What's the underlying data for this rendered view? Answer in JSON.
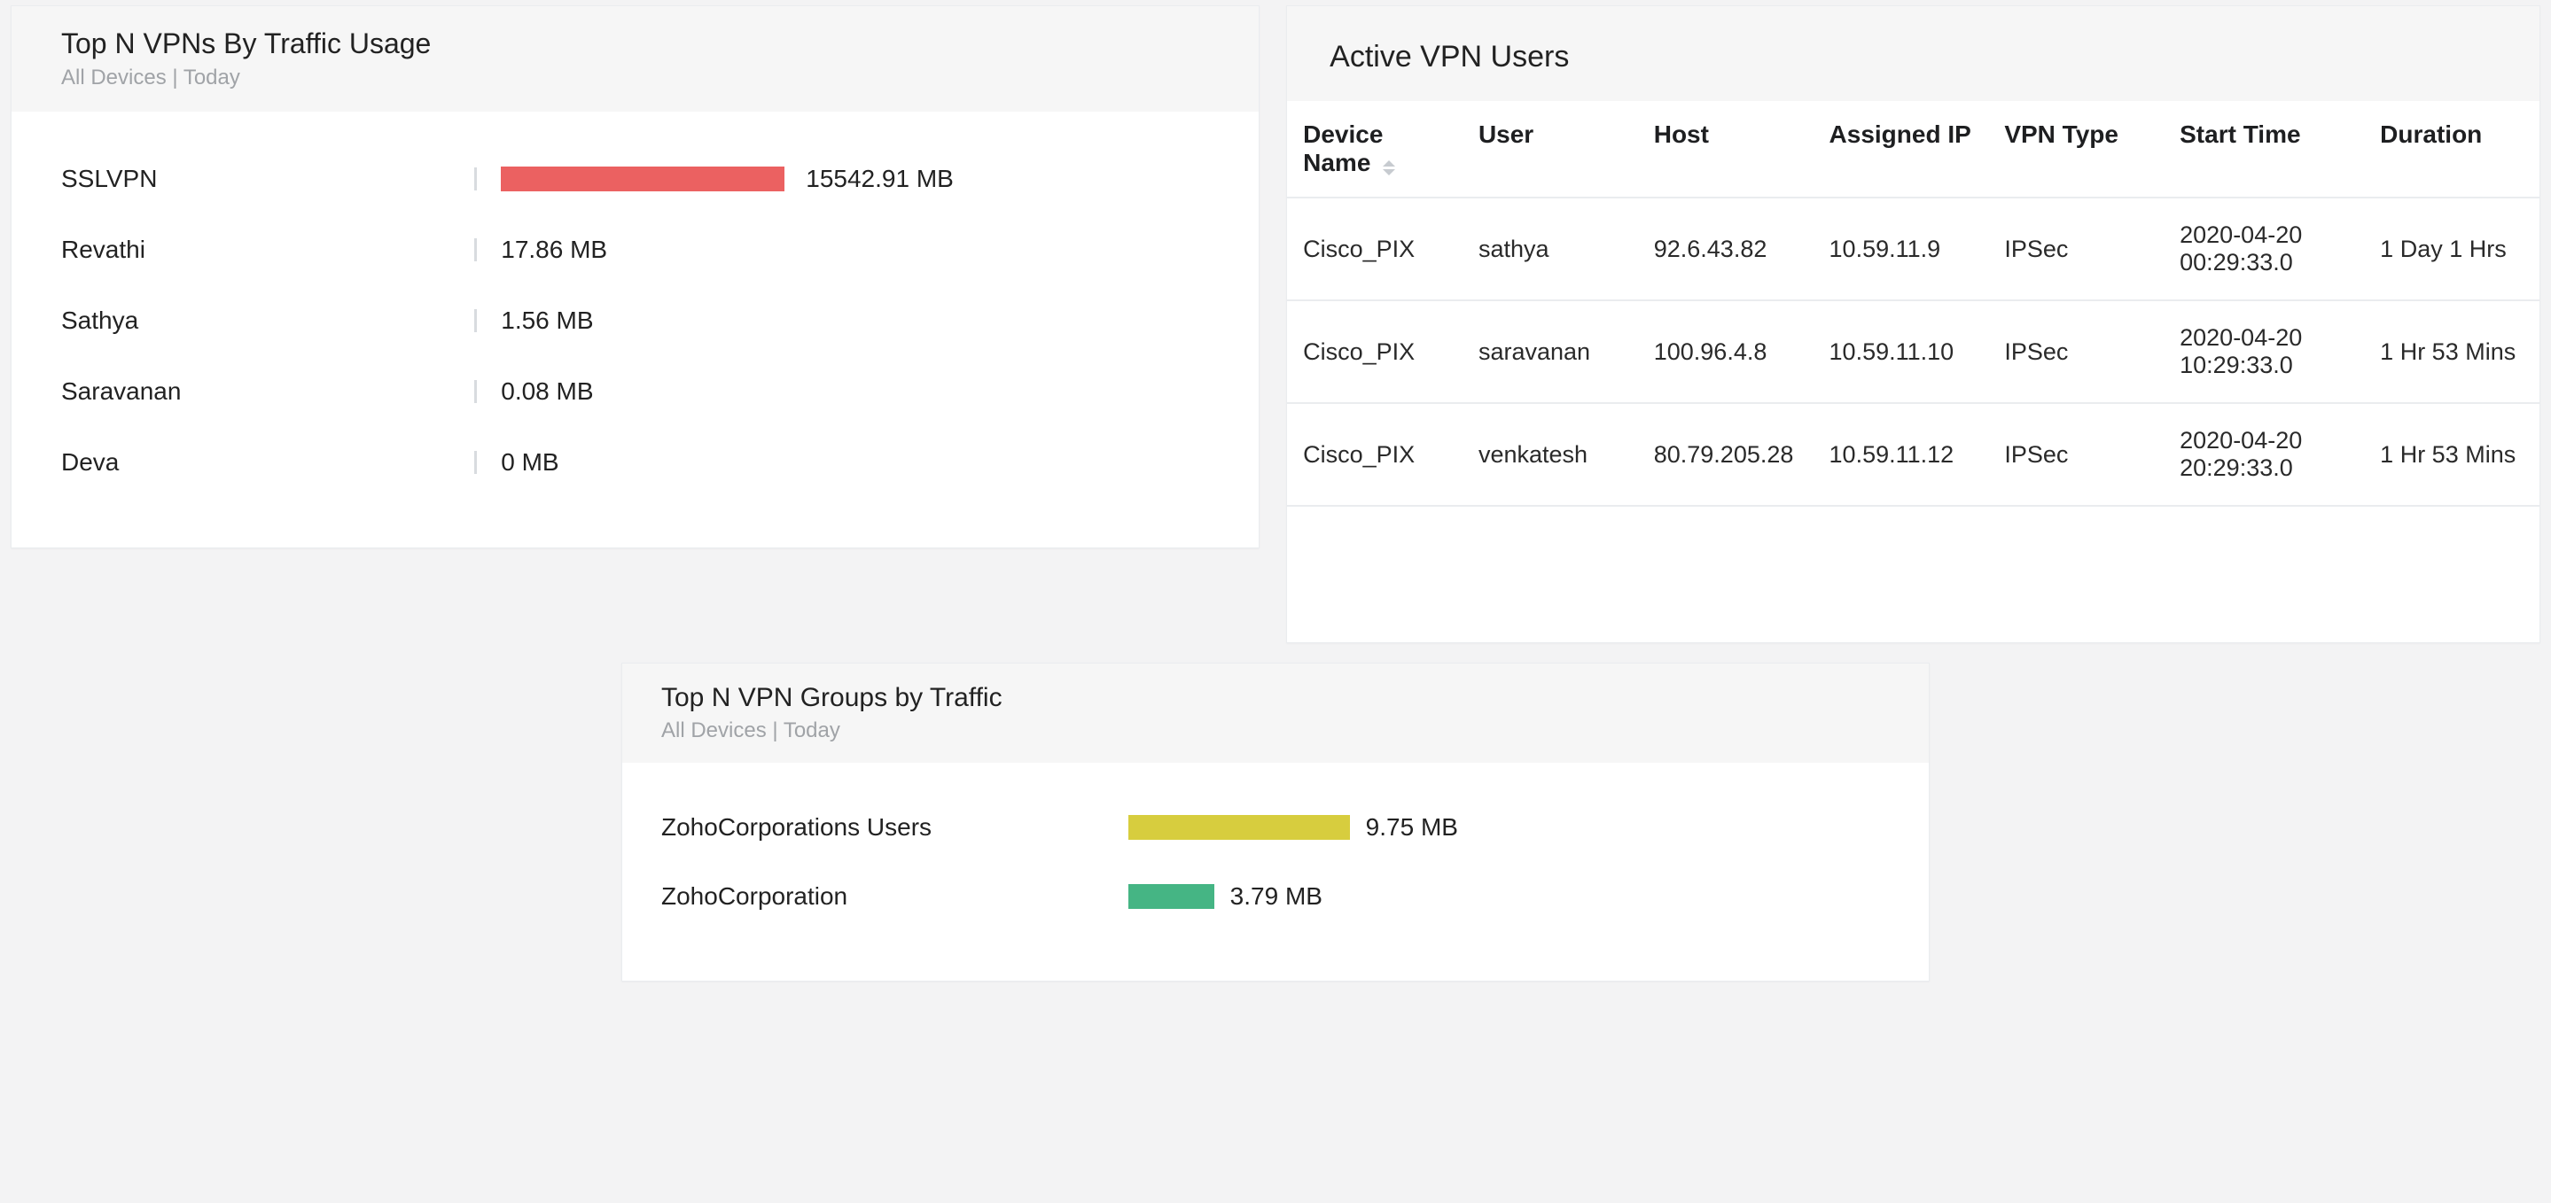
{
  "colors": {
    "bar_red": "#eb6161",
    "bar_yellow": "#d7cd3e",
    "bar_green": "#45b584"
  },
  "panels": {
    "traffic": {
      "title": "Top N VPNs By Traffic Usage",
      "subtitle": "All Devices | Today"
    },
    "active": {
      "title": "Active VPN Users",
      "columns": {
        "device": "Device Name",
        "user": "User",
        "host": "Host",
        "assigned_ip": "Assigned IP",
        "vpn_type": "VPN Type",
        "start_time": "Start Time",
        "duration": "Duration"
      },
      "rows": [
        {
          "device": "Cisco_PIX",
          "user": "sathya",
          "host": "92.6.43.82",
          "assigned_ip": "10.59.11.9",
          "vpn_type": "IPSec",
          "start_time": "2020-04-20 00:29:33.0",
          "duration": "1 Day 1 Hrs"
        },
        {
          "device": "Cisco_PIX",
          "user": "saravanan",
          "host": "100.96.4.8",
          "assigned_ip": "10.59.11.10",
          "vpn_type": "IPSec",
          "start_time": "2020-04-20 10:29:33.0",
          "duration": "1 Hr 53 Mins"
        },
        {
          "device": "Cisco_PIX",
          "user": "venkatesh",
          "host": "80.79.205.28",
          "assigned_ip": "10.59.11.12",
          "vpn_type": "IPSec",
          "start_time": "2020-04-20 20:29:33.0",
          "duration": "1 Hr 53 Mins"
        }
      ]
    },
    "groups": {
      "title": "Top N VPN Groups by Traffic",
      "subtitle": "All Devices | Today"
    }
  },
  "chart_data": [
    {
      "id": "traffic",
      "type": "bar",
      "orientation": "horizontal",
      "title": "Top N VPNs By Traffic Usage",
      "unit": "MB",
      "categories": [
        "SSLVPN",
        "Revathi",
        "Sathya",
        "Saravanan",
        "Deva"
      ],
      "values": [
        15542.91,
        17.86,
        1.56,
        0.08,
        0
      ],
      "value_labels": [
        "15542.91 MB",
        "17.86 MB",
        "1.56 MB",
        "0.08 MB",
        "0 MB"
      ],
      "colors": [
        "#eb6161",
        "#eb6161",
        "#eb6161",
        "#eb6161",
        "#eb6161"
      ]
    },
    {
      "id": "groups",
      "type": "bar",
      "orientation": "horizontal",
      "title": "Top N VPN Groups by Traffic",
      "unit": "MB",
      "categories": [
        "ZohoCorporations Users",
        "ZohoCorporation"
      ],
      "values": [
        9.75,
        3.79
      ],
      "value_labels": [
        "9.75 MB",
        "3.79 MB"
      ],
      "colors": [
        "#d7cd3e",
        "#45b584"
      ]
    }
  ]
}
